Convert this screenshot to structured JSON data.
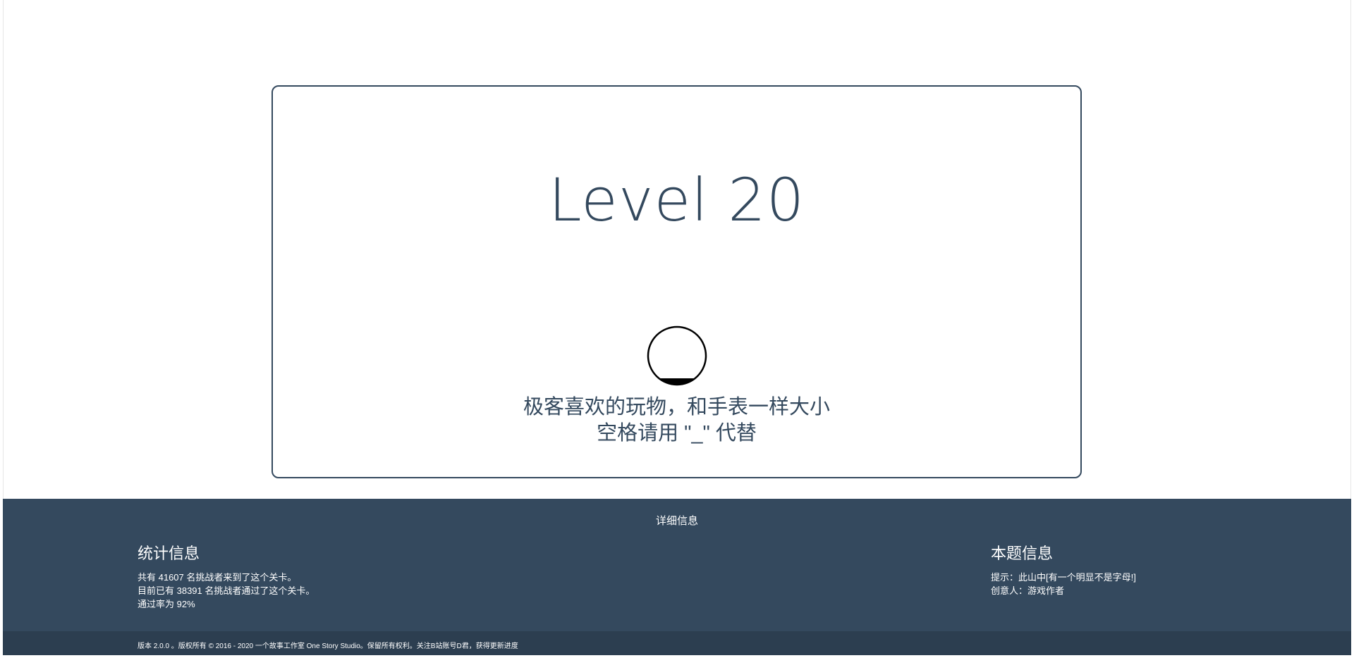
{
  "level": {
    "title": "Level 20"
  },
  "puzzle": {
    "hint_line1": "极客喜欢的玩物，和手表一样大小",
    "hint_line2": "空格请用 \"_\" 代替",
    "image_icon": "circle-icon"
  },
  "footer": {
    "heading": "详细信息",
    "stats": {
      "title": "统计信息",
      "line1": "共有 41607 名挑战者来到了这个关卡。",
      "line2": "目前已有 38391 名挑战者通过了这个关卡。",
      "line3": "通过率为 92%"
    },
    "info": {
      "title": "本题信息",
      "line1": "提示：此山中[有一个明显不是字母!]",
      "line2": "创意人：游戏作者"
    },
    "copyright": "版本 2.0.0 。版权所有 © 2016 - 2020 一个故事工作室 One Story Studio。保留所有权利。关注B站账号D君，获得更新进度"
  },
  "colors": {
    "primary": "#34495e",
    "footer_bottom": "#2c3e50",
    "background": "#ffffff"
  }
}
